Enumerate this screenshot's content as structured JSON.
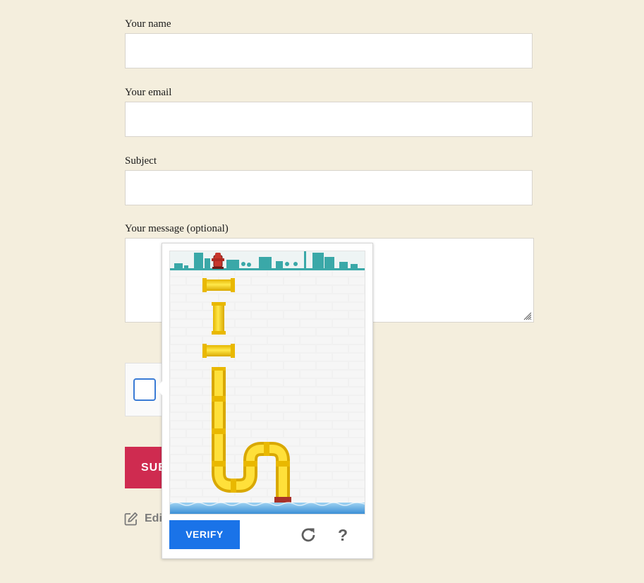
{
  "form": {
    "name_label": "Your name",
    "name_value": "",
    "email_label": "Your email",
    "email_value": "",
    "subject_label": "Subject",
    "subject_value": "",
    "message_label": "Your message (optional)",
    "message_value": "",
    "submit_label": "SUBMIT",
    "edit_label": "Edit"
  },
  "captcha": {
    "checkbox_checked": false,
    "verify_label": "VERIFY",
    "help_label": "?",
    "refresh_icon": "refresh-icon",
    "puzzle": {
      "scene": "pipe-connection-puzzle",
      "top_icon": "fire-hydrant-icon",
      "bottom_icon": "water-source-icon"
    }
  },
  "colors": {
    "page_background": "#f4eedd",
    "submit_background": "#cf2b50",
    "verify_background": "#1a73e8",
    "pipe_yellow": "#f7d21c",
    "skyline_teal": "#3aa8a8"
  }
}
